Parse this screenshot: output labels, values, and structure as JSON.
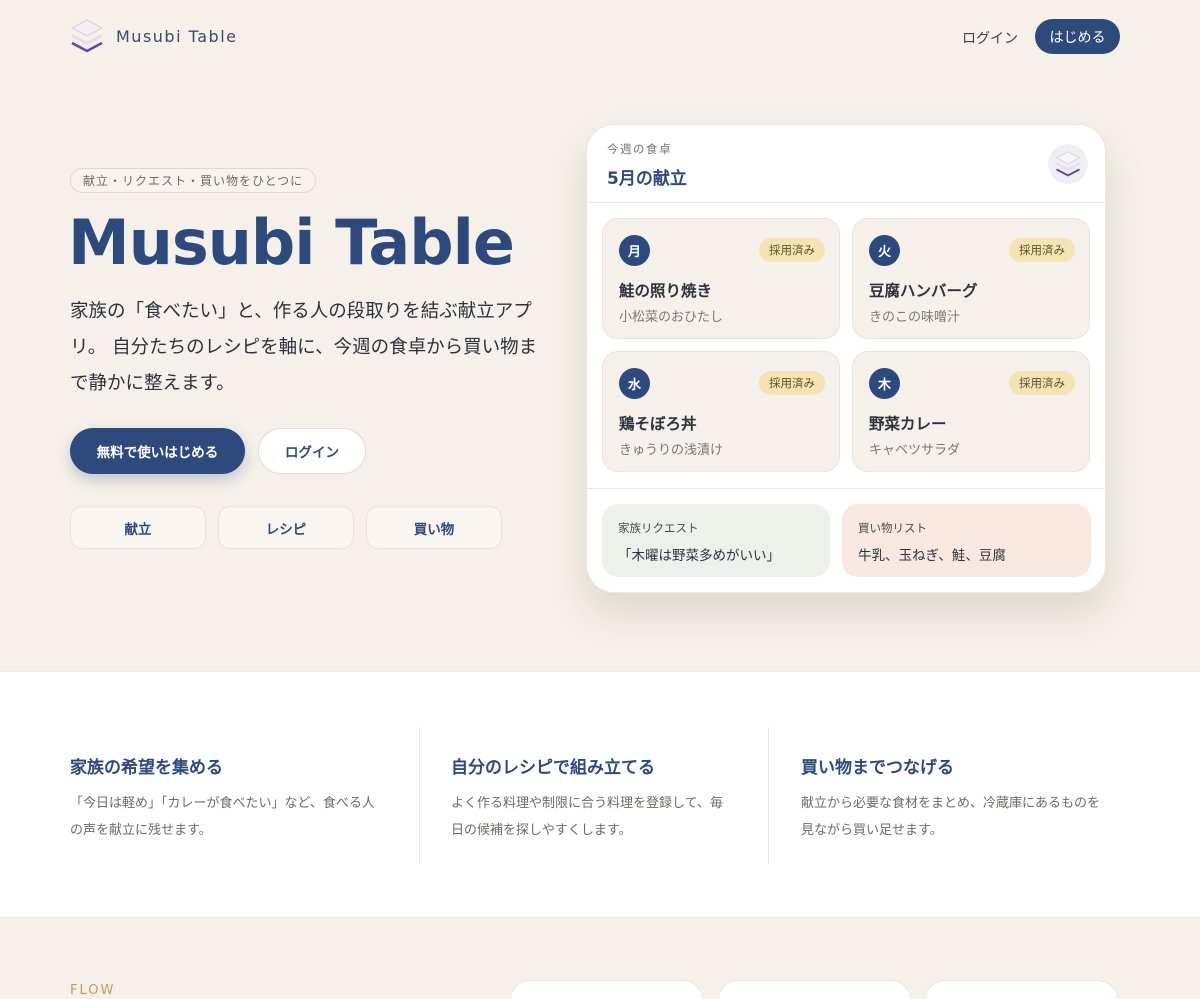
{
  "header": {
    "brand": "Musubi Table",
    "login_label": "ログイン",
    "start_label": "はじめる"
  },
  "hero": {
    "tagline": "献立・リクエスト・買い物をひとつに",
    "title": "Musubi Table",
    "description": "家族の「食べたい」と、作る人の段取りを結ぶ献立アプリ。 自分たちのレシピを軸に、今週の食卓から買い物まで静かに整えます。",
    "primary_cta": "無料で使いはじめる",
    "secondary_cta": "ログイン",
    "chips": [
      "献立",
      "レシピ",
      "買い物"
    ]
  },
  "card": {
    "eyebrow": "今週の食卓",
    "title": "5月の献立",
    "meals": [
      {
        "day": "月",
        "status": "採用済み",
        "main": "鮭の照り焼き",
        "side": "小松菜のおひたし"
      },
      {
        "day": "火",
        "status": "採用済み",
        "main": "豆腐ハンバーグ",
        "side": "きのこの味噌汁"
      },
      {
        "day": "水",
        "status": "採用済み",
        "main": "鶏そぼろ丼",
        "side": "きゅうりの浅漬け"
      },
      {
        "day": "木",
        "status": "採用済み",
        "main": "野菜カレー",
        "side": "キャベツサラダ"
      }
    ],
    "request": {
      "label": "家族リクエスト",
      "text": "「木曜は野菜多めがいい」"
    },
    "shopping": {
      "label": "買い物リスト",
      "text": "牛乳、玉ねぎ、鮭、豆腐"
    }
  },
  "features": [
    {
      "title": "家族の希望を集める",
      "desc_lines": [
        "「今日は軽め」「カレーが食べたい」など、食べる人",
        "の声を献立に残せます。"
      ]
    },
    {
      "title": "自分のレシピで組み立てる",
      "desc_lines": [
        "よく作る料理や制限に合う料理を登録して、毎",
        "日の候補を探しやすくします。"
      ]
    },
    {
      "title": "買い物までつなげる",
      "desc_lines": [
        "献立から必要な食材をまとめ、冷蔵庫にあるものを",
        "見ながら買い足せます。"
      ]
    }
  ],
  "flow": {
    "label": "FLOW"
  },
  "colors": {
    "navy": "#2e4a7d",
    "background": "#f5f0e9",
    "badge": "#f4e4b3",
    "request_bg": "#edf1ea",
    "shopping_bg": "#f8e8e0",
    "flow_accent": "#c99a58"
  },
  "icons": {
    "logo": "stacked-layers-icon",
    "avatar": "stacked-layers-icon"
  }
}
